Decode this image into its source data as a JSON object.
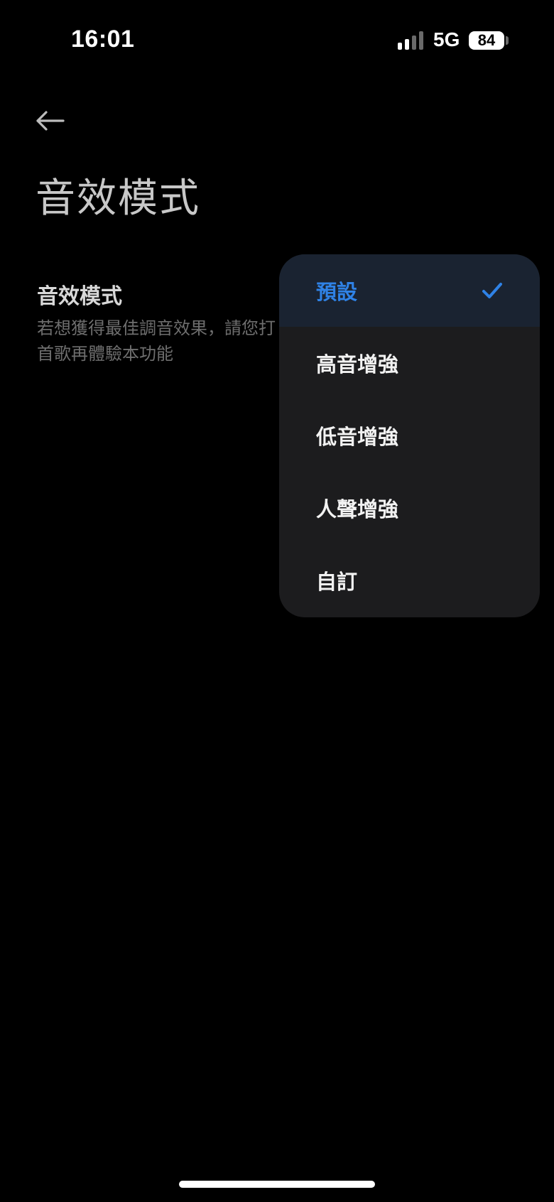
{
  "status_bar": {
    "time": "16:01",
    "network": "5G",
    "battery": "84"
  },
  "header": {
    "back_icon": "arrow-left-icon",
    "title": "音效模式"
  },
  "setting": {
    "title": "音效模式",
    "description": "若想獲得最佳調音效果，請您打\n首歌再體驗本功能"
  },
  "dropdown": {
    "selected_index": 0,
    "items": [
      {
        "label": "預設",
        "selected": true
      },
      {
        "label": "高音增強",
        "selected": false
      },
      {
        "label": "低音增強",
        "selected": false
      },
      {
        "label": "人聲增強",
        "selected": false
      },
      {
        "label": "自訂",
        "selected": false
      }
    ],
    "check_icon": "checkmark-icon"
  },
  "colors": {
    "background": "#000000",
    "menu_background": "#1c1c1e",
    "selected_background": "#1a2331",
    "accent": "#2f82e6"
  }
}
